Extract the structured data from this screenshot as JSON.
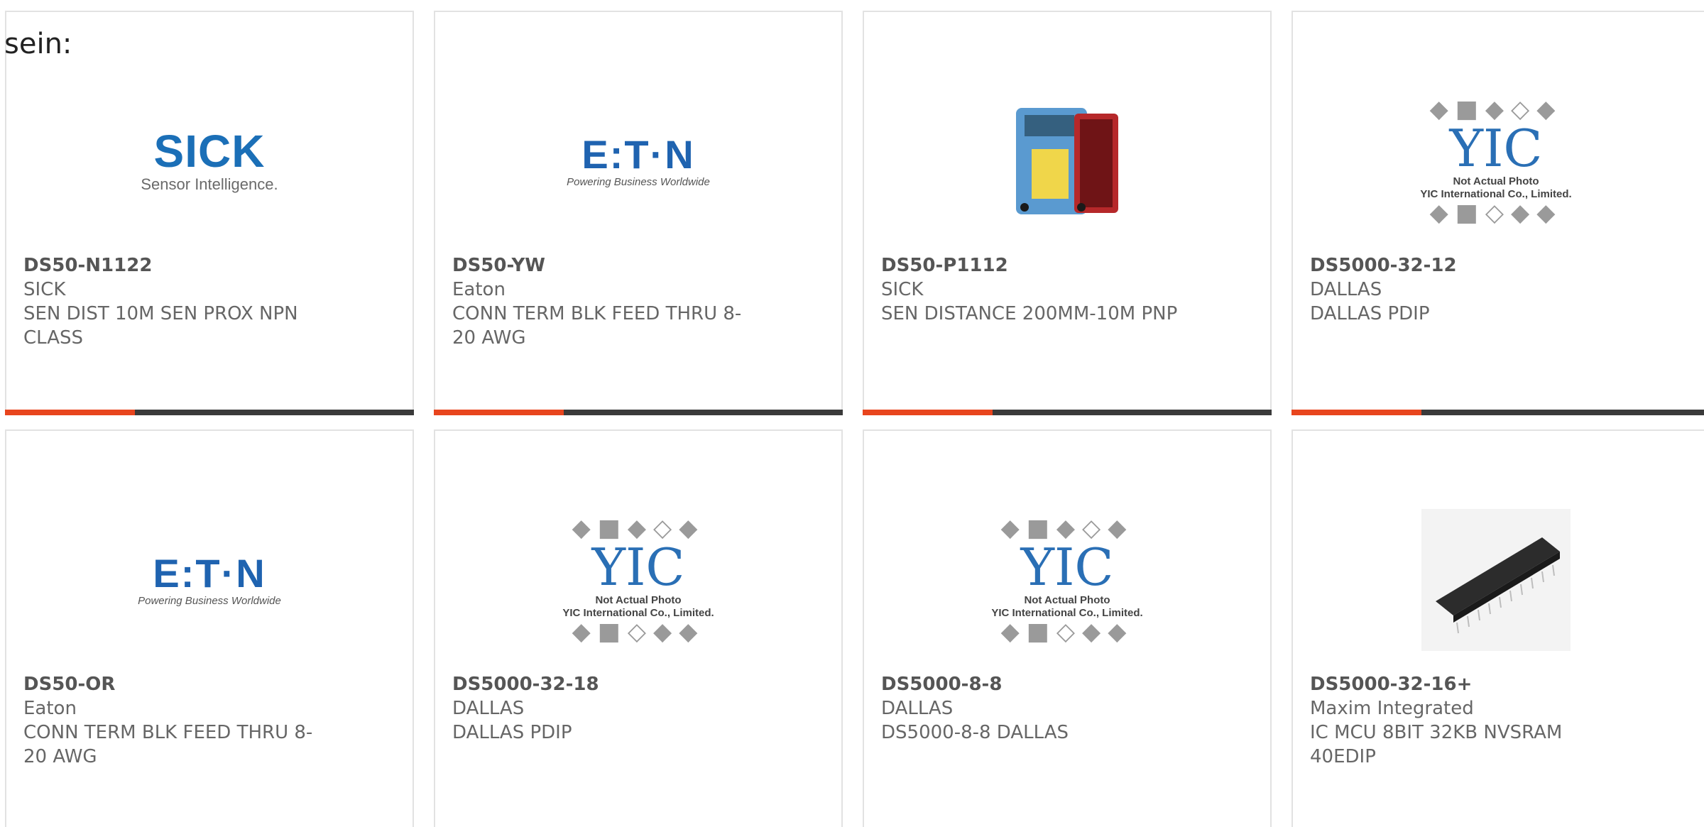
{
  "lead_text": "sein:",
  "cards": [
    {
      "part": "DS50-N1122",
      "maker": "SICK",
      "desc1": "SEN DIST 10M SEN PROX NPN",
      "desc2": "CLASS",
      "image": "sick-logo"
    },
    {
      "part": "DS50-YW",
      "maker": "Eaton",
      "desc1": "CONN TERM BLK FEED THRU 8-",
      "desc2": "20 AWG",
      "image": "eaton-logo"
    },
    {
      "part": "DS50-P1112",
      "maker": "SICK",
      "desc1": "SEN DISTANCE 200MM-10M PNP",
      "desc2": "",
      "image": "sensor-photo"
    },
    {
      "part": "DS5000-32-12",
      "maker": "DALLAS",
      "desc1": "DALLAS PDIP",
      "desc2": "",
      "image": "yic-placeholder"
    },
    {
      "part": "DS50-OR",
      "maker": "Eaton",
      "desc1": "CONN TERM BLK FEED THRU 8-",
      "desc2": "20 AWG",
      "image": "eaton-logo"
    },
    {
      "part": "DS5000-32-18",
      "maker": "DALLAS",
      "desc1": "DALLAS PDIP",
      "desc2": "",
      "image": "yic-placeholder"
    },
    {
      "part": "DS5000-8-8",
      "maker": "DALLAS",
      "desc1": "DS5000-8-8 DALLAS",
      "desc2": "",
      "image": "yic-placeholder"
    },
    {
      "part": "DS5000-32-16+",
      "maker": "Maxim Integrated",
      "desc1": "IC MCU 8BIT 32KB NVSRAM",
      "desc2": "40EDIP",
      "image": "ic-photo"
    }
  ],
  "logos": {
    "sick_word": "SICK",
    "sick_tag": "Sensor Intelligence.",
    "eaton_word": "E:T·N",
    "eaton_tag": "Powering Business Worldwide",
    "yic_word": "YIC",
    "yic_cap1": "Not Actual Photo",
    "yic_cap2": "YIC International Co., Limited."
  },
  "colors": {
    "accent": "#e8451e",
    "bar": "#3a3a3a",
    "brand_blue": "#1b6fb7"
  }
}
